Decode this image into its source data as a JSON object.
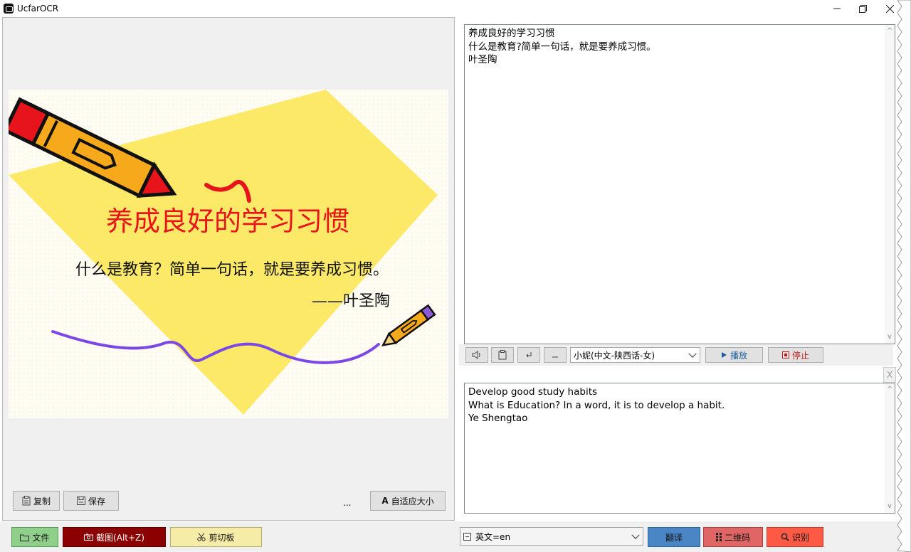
{
  "window": {
    "title": "UcfarOCR"
  },
  "slide": {
    "title": "养成良好的学习习惯",
    "subtitle": "什么是教育？简单一句话，就是要养成习惯。",
    "author": "——叶圣陶"
  },
  "left_toolbar": {
    "copy_label": "复制",
    "save_label": "保存",
    "ellipsis": "...",
    "fit_label": "自适应大小"
  },
  "ocr_result": {
    "lines": [
      "养成良好的学习习惯",
      "什么是教育?简单一句话，就是要养成习惯。",
      "叶圣陶"
    ]
  },
  "tts": {
    "voice_selected": "小妮(中文-陕西话-女)",
    "play_label": "播放",
    "stop_label": "停止",
    "close_label": "X"
  },
  "translation": {
    "lines": [
      "Develop good study habits",
      "What is Education? In a word, it is to develop a habit.",
      "Ye Shengtao"
    ]
  },
  "bottom_bar": {
    "file_label": "文件",
    "screenshot_label": "截图(Alt+Z)",
    "clipboard_label": "剪切板",
    "language_selected": "英文=en",
    "translate_label": "翻译",
    "qrcode_label": "二维码",
    "recognize_label": "识别"
  },
  "colors": {
    "file_btn": "#8fcf8a",
    "screenshot_btn": "#8b0000",
    "clipboard_btn": "#f5eca8",
    "translate_btn": "#4a86c5",
    "qrcode_btn": "#e06666",
    "recognize_btn": "#ff5a45",
    "slide_title": "#e8141b",
    "diamond": "#fde968"
  }
}
